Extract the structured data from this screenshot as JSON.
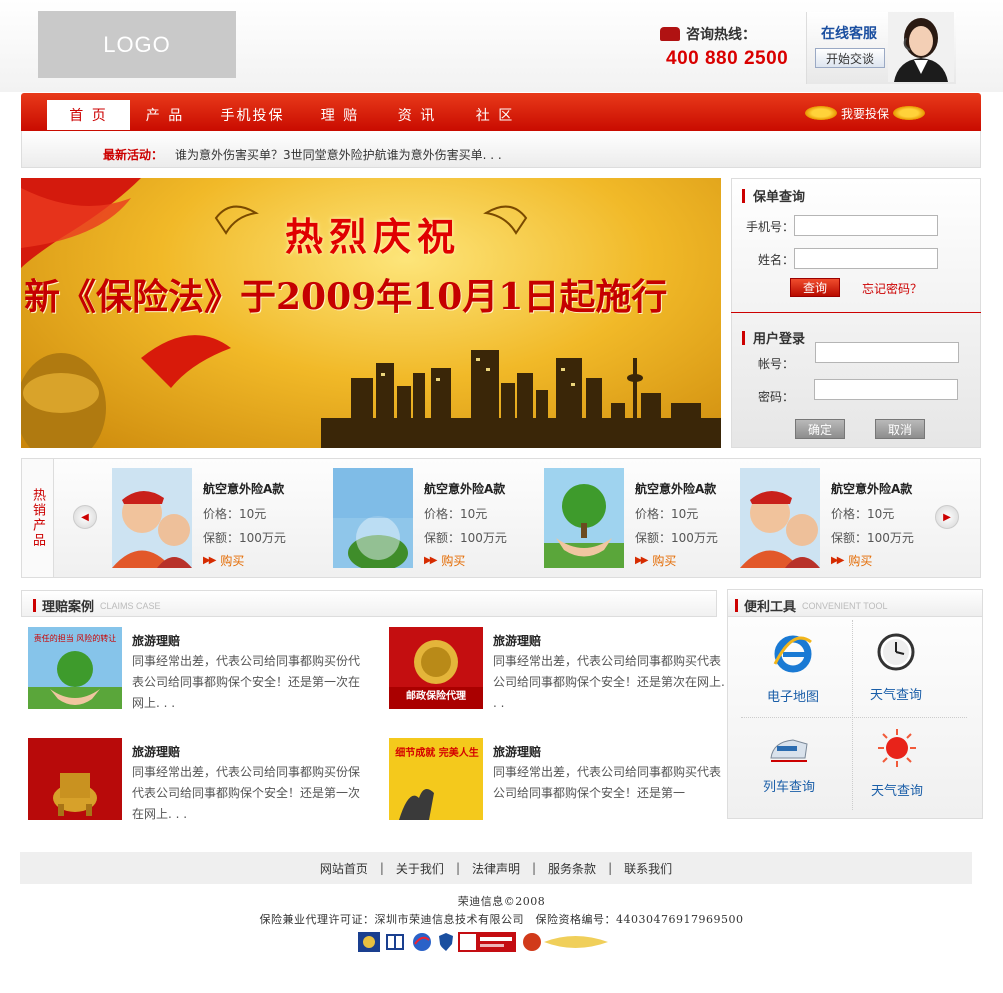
{
  "header": {
    "logo_text": "LOGO",
    "hotline_label": "咨询热线：",
    "hotline_number": "400 880 2500",
    "service_title": "在线客服",
    "service_button": "开始交谈"
  },
  "nav": {
    "items": [
      {
        "label": "首 页"
      },
      {
        "label": "产 品"
      },
      {
        "label": "手机投保"
      },
      {
        "label": "理 赔"
      },
      {
        "label": "资 讯"
      },
      {
        "label": "社 区"
      }
    ],
    "insure_label": "我要投保"
  },
  "news": {
    "label": "最新活动：",
    "text": "谁为意外伤害买单？3世同堂意外险护航谁为意外伤害买单. . ."
  },
  "banner": {
    "title": "热烈庆祝",
    "subtitle": "新《保险法》于2009年10月1日起施行"
  },
  "policy_query": {
    "title": "保单查询",
    "phone_label": "手机号：",
    "phone_value": "",
    "name_label": "姓名：",
    "name_value": "",
    "query_button": "查询",
    "forgot_link": "忘记密码？"
  },
  "login": {
    "title": "用户登录",
    "account_label": "帐号：",
    "account_value": "",
    "password_label": "密码：",
    "password_value": "",
    "confirm_button": "确定",
    "cancel_button": "取消"
  },
  "hot_products": {
    "label": "热销产品",
    "items": [
      {
        "name": "航空意外险A款",
        "price": "价格：10元",
        "coverage": "保额：100万元",
        "buy": "购买"
      },
      {
        "name": "航空意外险A款",
        "price": "价格：10元",
        "coverage": "保额：100万元",
        "buy": "购买"
      },
      {
        "name": "航空意外险A款",
        "price": "价格：10元",
        "coverage": "保额：100万元",
        "buy": "购买"
      },
      {
        "name": "航空意外险A款",
        "price": "价格：10元",
        "coverage": "保额：100万元",
        "buy": "购买"
      }
    ]
  },
  "claims": {
    "title": "理赔案例",
    "title_en": "CLAIMS CASE",
    "cases": [
      {
        "title": "旅游理赔",
        "text": "同事经常出差，代表公司给同事都购买份代表公司给同事都购保个安全！还是第一次在网上. . ."
      },
      {
        "title": "旅游理赔",
        "text": "同事经常出差，代表公司给同事都购买代表公司给同事都购保个安全！还是第次在网上. . ."
      },
      {
        "title": "旅游理赔",
        "text": "同事经常出差，代表公司给同事都购买份保代表公司给同事都购保个安全！还是第一次在网上. . ."
      },
      {
        "title": "旅游理赔",
        "text": "同事经常出差，代表公司给同事都购买代表公司给同事都购保个安全！还是第一"
      }
    ],
    "image_texts": [
      "责任的担当 风险的转让",
      "邮政保险代理",
      "细节成就 完美人生"
    ]
  },
  "tools": {
    "title": "便利工具",
    "title_en": "CONVENIENT TOOL",
    "items": [
      {
        "label": "电子地图",
        "icon": "ie-icon"
      },
      {
        "label": "天气查询",
        "icon": "clock-icon"
      },
      {
        "label": "列车查询",
        "icon": "train-icon"
      },
      {
        "label": "天气查询",
        "icon": "sun-icon"
      }
    ]
  },
  "footer": {
    "links": [
      "网站首页",
      "关于我们",
      "法律声明",
      "服务条款",
      "联系我们"
    ],
    "copyright": "荣迪信息©2008",
    "license": "保险兼业代理许可证：深圳市荣迪信息技术有限公司　保险资格编号：44030476917969500"
  },
  "colors": {
    "brand_red": "#c90b00",
    "link_blue": "#1a5ea8",
    "buy_orange": "#e46a00"
  }
}
